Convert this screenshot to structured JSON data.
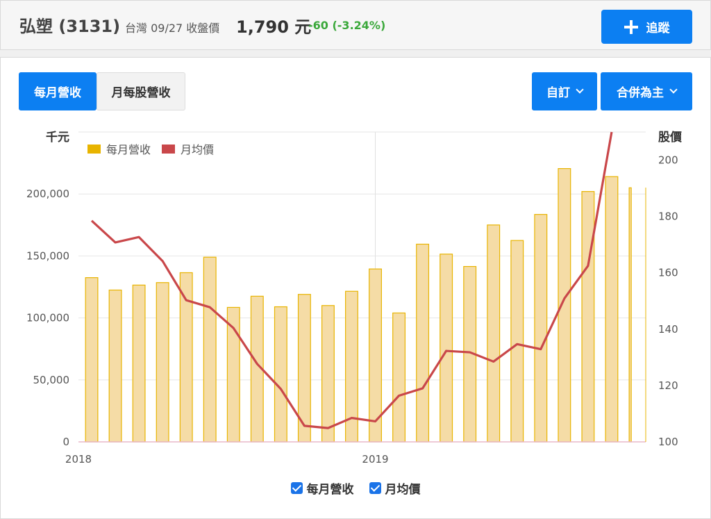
{
  "header": {
    "stock_name": "弘塑 (3131)",
    "meta": "台灣 09/27 收盤價",
    "price": "1,790 元",
    "change": "-60 (-3.24%)",
    "track_label": "追蹤"
  },
  "tabs": [
    {
      "label": "每月營收"
    },
    {
      "label": "月每股營收"
    }
  ],
  "dropdowns": {
    "custom_label": "自訂",
    "consolidated_label": "合併為主"
  },
  "toggles": [
    {
      "label": "每月營收"
    },
    {
      "label": "月均價"
    }
  ],
  "colors": {
    "accent": "#0c7ff2",
    "bar_fill": "#f5dca6",
    "bar_stroke": "#e8b400",
    "line": "#c9474a",
    "change_up_down": "#3aa83a"
  },
  "chart_data": {
    "type": "bar",
    "left_unit": "千元",
    "right_unit": "股價",
    "legend": [
      "每月營收",
      "月均價"
    ],
    "left_ticks": [
      "0",
      "50,000",
      "100,000",
      "150,000",
      "200,000"
    ],
    "right_ticks": [
      "100",
      "120",
      "140",
      "160",
      "180",
      "200"
    ],
    "x_ticks": [
      "2018",
      "2019"
    ],
    "ylim_left": [
      0,
      250000
    ],
    "ylim_right": [
      100,
      210
    ],
    "x": [
      "2018-01",
      "2018-02",
      "2018-03",
      "2018-04",
      "2018-05",
      "2018-06",
      "2018-07",
      "2018-08",
      "2018-09",
      "2018-10",
      "2018-11",
      "2018-12",
      "2019-01",
      "2019-02",
      "2019-03",
      "2019-04",
      "2019-05",
      "2019-06",
      "2019-07",
      "2019-08",
      "2019-09",
      "2019-10",
      "2019-11",
      "2019-12"
    ],
    "series": [
      {
        "name": "每月營收",
        "axis": "left",
        "values": [
          132500,
          122500,
          126500,
          128500,
          136500,
          149000,
          108500,
          117500,
          109000,
          119000,
          110000,
          121500,
          139500,
          104000,
          159500,
          151500,
          141500,
          175000,
          162500,
          183500,
          220500,
          202000,
          214000,
          205000
        ]
      },
      {
        "name": "月均價",
        "axis": "right",
        "values": [
          178.5,
          170.8,
          172.7,
          164.2,
          150.3,
          147.8,
          140.4,
          127.7,
          118.8,
          105.7,
          104.9,
          108.5,
          107.3,
          116.4,
          119.0,
          132.3,
          131.8,
          128.5,
          134.7,
          132.9,
          150.9,
          162.5,
          210
        ]
      }
    ]
  }
}
